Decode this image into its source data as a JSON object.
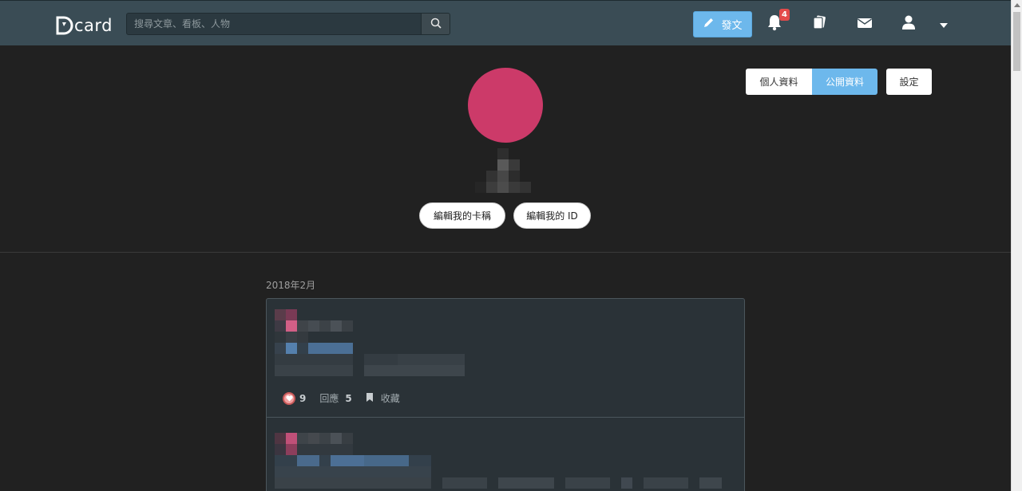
{
  "header": {
    "logo_text": "card",
    "search": {
      "placeholder": "搜尋文章、看板、人物"
    },
    "post_button": "發文",
    "notification_count": "4",
    "icons": [
      "search-icon",
      "pencil-icon",
      "bell-icon",
      "cards-icon",
      "mail-icon",
      "user-icon",
      "caret-down-icon"
    ]
  },
  "profile": {
    "edit_card_button": "編輯我的卡稱",
    "edit_id_button": "編輯我的 ID",
    "tabs": {
      "private": "個人資料",
      "public": "公開資料"
    },
    "settings_button": "設定",
    "avatar_color": "#cc3a69"
  },
  "feed": {
    "month": "2018年2月",
    "posts": [
      {
        "likes": "9",
        "reply_label": "回應",
        "replies": "5",
        "bookmark_label": "收藏"
      }
    ]
  },
  "colors": {
    "header_bg": "#3a4c55",
    "page_bg": "#212121",
    "accent": "#6db8ec",
    "card_bg": "#2a3237",
    "badge": "#e34a4a"
  }
}
